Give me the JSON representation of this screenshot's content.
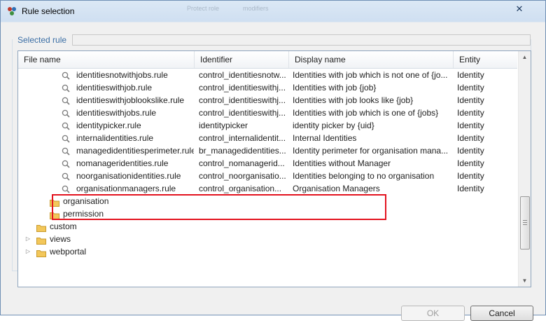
{
  "window": {
    "title": "Rule selection",
    "close_glyph": "✕",
    "faint_title_texts": [
      "Protect role",
      "modifiers"
    ]
  },
  "selected_rule": {
    "label": "Selected rule",
    "value": ""
  },
  "table": {
    "columns": [
      "File name",
      "Identifier",
      "Display name",
      "Entity"
    ],
    "rows": [
      {
        "type": "rule",
        "file": "identitiesnotwithjobs.rule",
        "identifier": "control_identitiesnotw...",
        "display": "Identities with job which is not one of {jo...",
        "entity": "Identity"
      },
      {
        "type": "rule",
        "file": "identitieswithjob.rule",
        "identifier": "control_identitieswithj...",
        "display": "Identities with job {job}",
        "entity": "Identity"
      },
      {
        "type": "rule",
        "file": "identitieswithjoblookslike.rule",
        "identifier": "control_identitieswithj...",
        "display": "Identities with job looks like {job}",
        "entity": "Identity"
      },
      {
        "type": "rule",
        "file": "identitieswithjobs.rule",
        "identifier": "control_identitieswithj...",
        "display": "Identities with job which is one of {jobs}",
        "entity": "Identity"
      },
      {
        "type": "rule",
        "file": "identitypicker.rule",
        "identifier": "identitypicker",
        "display": "identity picker by {uid}",
        "entity": "Identity"
      },
      {
        "type": "rule",
        "file": "internalidentities.rule",
        "identifier": "control_internalidentit...",
        "display": "Internal Identities",
        "entity": "Identity"
      },
      {
        "type": "rule",
        "file": "managedidentitiesperimeter.rule",
        "identifier": "br_managedidentities...",
        "display": "Identity perimeter for organisation mana...",
        "entity": "Identity"
      },
      {
        "type": "rule",
        "file": "nomanageridentities.rule",
        "identifier": "control_nomanagerid...",
        "display": "Identities without Manager",
        "entity": "Identity"
      },
      {
        "type": "rule",
        "file": "noorganisationidentities.rule",
        "identifier": "control_noorganisatio...",
        "display": "Identities belonging to no organisation",
        "entity": "Identity"
      },
      {
        "type": "rule",
        "file": "organisationmanagers.rule",
        "identifier": "control_organisation...",
        "display": "Organisation Managers",
        "entity": "Identity"
      },
      {
        "type": "folder",
        "file": "organisation",
        "identifier": "",
        "display": "",
        "entity": ""
      },
      {
        "type": "folder",
        "file": "permission",
        "identifier": "",
        "display": "",
        "entity": ""
      },
      {
        "type": "folder",
        "file": "custom",
        "identifier": "",
        "display": "",
        "entity": ""
      },
      {
        "type": "folder",
        "file": "views",
        "identifier": "",
        "display": "",
        "entity": ""
      },
      {
        "type": "folder",
        "file": "webportal",
        "identifier": "",
        "display": "",
        "entity": ""
      }
    ]
  },
  "buttons": {
    "ok": "OK",
    "cancel": "Cancel"
  },
  "colors": {
    "accent_label": "#3a6ea5",
    "highlight_border": "#e3131f",
    "folder": "#f3c75a"
  },
  "icons": {
    "row_rule": "search-icon",
    "row_folder": "folder-icon",
    "expand": "expand-arrow-icon"
  }
}
